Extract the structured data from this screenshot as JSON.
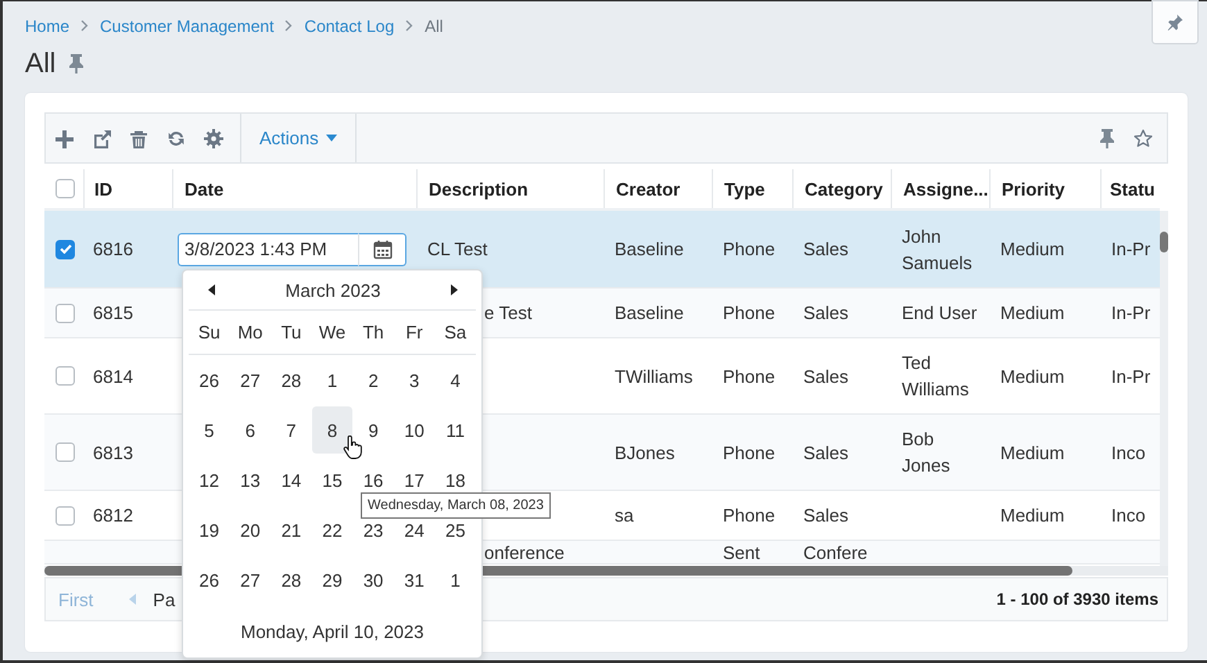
{
  "breadcrumb": [
    {
      "label": "Home",
      "current": false
    },
    {
      "label": "Customer Management",
      "current": false
    },
    {
      "label": "Contact Log",
      "current": false
    },
    {
      "label": "All",
      "current": true
    }
  ],
  "page_title": "All",
  "toolbar": {
    "actions_label": "Actions"
  },
  "table": {
    "header_checked": false,
    "columns": [
      "ID",
      "Date",
      "Description",
      "Creator",
      "Type",
      "Category",
      "Assigne...",
      "Priority",
      "Statu"
    ],
    "rows": [
      {
        "kind": "row",
        "selected": true,
        "editing": true,
        "id": "6816",
        "date": "3/8/2023 1:43 PM",
        "description": "CL Test",
        "creator": "Baseline",
        "type": "Phone",
        "category": "Sales",
        "assignee": "John Samuels",
        "priority": "Medium",
        "status": "In-Pr"
      },
      {
        "kind": "row",
        "selected": false,
        "editing": false,
        "id": "6815",
        "description": "e Test",
        "creator": "Baseline",
        "type": "Phone",
        "category": "Sales",
        "assignee": "End User",
        "priority": "Medium",
        "status": "In-Pr"
      },
      {
        "kind": "row",
        "selected": false,
        "editing": false,
        "id": "6814",
        "creator": "TWilliams",
        "type": "Phone",
        "category": "Sales",
        "assignee": "Ted Williams",
        "priority": "Medium",
        "status": "In-Pr"
      },
      {
        "kind": "row",
        "selected": false,
        "editing": false,
        "id": "6813",
        "creator": "BJones",
        "type": "Phone",
        "category": "Sales",
        "assignee": "Bob Jones",
        "priority": "Medium",
        "status": "Inco"
      },
      {
        "kind": "row",
        "selected": false,
        "editing": false,
        "id": "6812",
        "creator": "sa",
        "type": "Phone",
        "category": "Sales",
        "priority": "Medium",
        "status": "Inco"
      },
      {
        "kind": "partial",
        "description": "onference",
        "type": "Sent",
        "category": "Confere"
      }
    ]
  },
  "pager": {
    "first_label": "First",
    "first_disabled": true,
    "page_label": "Pa",
    "summary": "1 - 100 of 3930 items"
  },
  "calendar": {
    "month_title": "March 2023",
    "weekdays": [
      "Su",
      "Mo",
      "Tu",
      "We",
      "Th",
      "Fr",
      "Sa"
    ],
    "weeks": [
      [
        {
          "day": "26",
          "hovered": false
        },
        {
          "day": "27",
          "hovered": false
        },
        {
          "day": "28",
          "hovered": false
        },
        {
          "day": "1",
          "hovered": false
        },
        {
          "day": "2",
          "hovered": false
        },
        {
          "day": "3",
          "hovered": false
        },
        {
          "day": "4",
          "hovered": false
        }
      ],
      [
        {
          "day": "5",
          "hovered": false
        },
        {
          "day": "6",
          "hovered": false
        },
        {
          "day": "7",
          "hovered": false
        },
        {
          "day": "8",
          "hovered": true
        },
        {
          "day": "9",
          "hovered": false
        },
        {
          "day": "10",
          "hovered": false
        },
        {
          "day": "11",
          "hovered": false
        }
      ],
      [
        {
          "day": "12",
          "hovered": false
        },
        {
          "day": "13",
          "hovered": false
        },
        {
          "day": "14",
          "hovered": false
        },
        {
          "day": "15",
          "hovered": false
        },
        {
          "day": "16",
          "hovered": false
        },
        {
          "day": "17",
          "hovered": false
        },
        {
          "day": "18",
          "hovered": false
        }
      ],
      [
        {
          "day": "19",
          "hovered": false
        },
        {
          "day": "20",
          "hovered": false
        },
        {
          "day": "21",
          "hovered": false
        },
        {
          "day": "22",
          "hovered": false
        },
        {
          "day": "23",
          "hovered": false
        },
        {
          "day": "24",
          "hovered": false
        },
        {
          "day": "25",
          "hovered": false
        }
      ],
      [
        {
          "day": "26",
          "hovered": false
        },
        {
          "day": "27",
          "hovered": false
        },
        {
          "day": "28",
          "hovered": false
        },
        {
          "day": "29",
          "hovered": false
        },
        {
          "day": "30",
          "hovered": false
        },
        {
          "day": "31",
          "hovered": false
        },
        {
          "day": "1",
          "hovered": false
        }
      ]
    ],
    "today_label": "Monday, April 10, 2023",
    "tooltip": "Wednesday, March 08, 2023"
  }
}
